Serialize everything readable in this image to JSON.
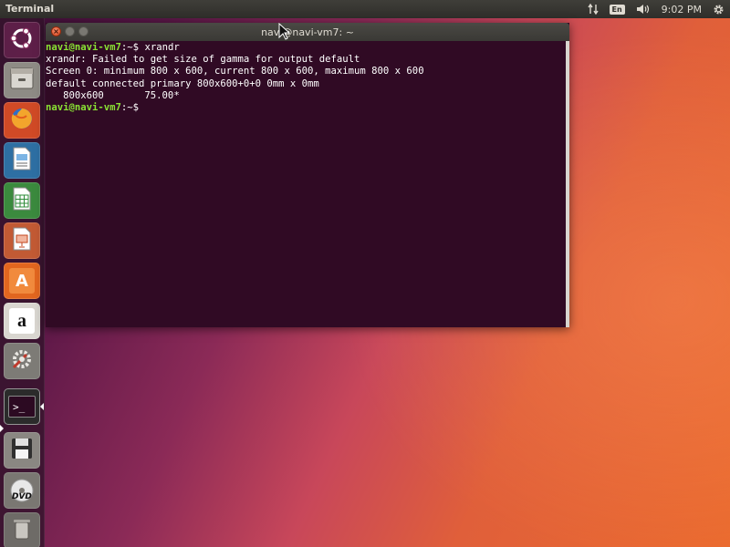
{
  "top_panel": {
    "app_title": "Terminal",
    "keyboard_layout": "En",
    "clock": "9:02 PM",
    "network_icon": "network-updown-icon",
    "volume_icon": "volume-icon",
    "settings_icon": "gear-icon"
  },
  "launcher": {
    "items": [
      {
        "name": "ubuntu-dash",
        "icon": "ubuntu-logo-icon"
      },
      {
        "name": "files",
        "icon": "file-cabinet-icon"
      },
      {
        "name": "firefox",
        "icon": "firefox-icon"
      },
      {
        "name": "libreoffice-writer",
        "icon": "document-icon"
      },
      {
        "name": "libreoffice-calc",
        "icon": "spreadsheet-icon"
      },
      {
        "name": "libreoffice-impress",
        "icon": "presentation-icon"
      },
      {
        "name": "ubuntu-software",
        "icon": "shopping-bag-icon"
      },
      {
        "name": "amazon",
        "icon": "amazon-icon"
      },
      {
        "name": "system-settings",
        "icon": "settings-tools-icon"
      },
      {
        "name": "terminal",
        "icon": "terminal-icon"
      },
      {
        "name": "save-disk",
        "icon": "floppy-disk-icon"
      },
      {
        "name": "dvd",
        "icon": "dvd-icon"
      },
      {
        "name": "trash",
        "icon": "trash-icon"
      }
    ],
    "dvd_label": "DVD",
    "amazon_label": "a",
    "software_label": "A",
    "terminal_glyph": ">_"
  },
  "window": {
    "title": "navi@navi-vm7: ~",
    "close_glyph": "×",
    "lines": [
      {
        "prompt": "navi@navi-vm7",
        "path": ":~$",
        "text": " xrandr"
      },
      {
        "prompt": "",
        "path": "",
        "text": "xrandr: Failed to get size of gamma for output default"
      },
      {
        "prompt": "",
        "path": "",
        "text": "Screen 0: minimum 800 x 600, current 800 x 600, maximum 800 x 600"
      },
      {
        "prompt": "",
        "path": "",
        "text": "default connected primary 800x600+0+0 0mm x 0mm"
      },
      {
        "prompt": "",
        "path": "",
        "text": "   800x600       75.00*"
      },
      {
        "prompt": "navi@navi-vm7",
        "path": ":~$",
        "text": " "
      }
    ]
  },
  "colors": {
    "terminal_bg": "#300a24",
    "prompt_green": "#8ae234",
    "accent_orange": "#e95420"
  }
}
